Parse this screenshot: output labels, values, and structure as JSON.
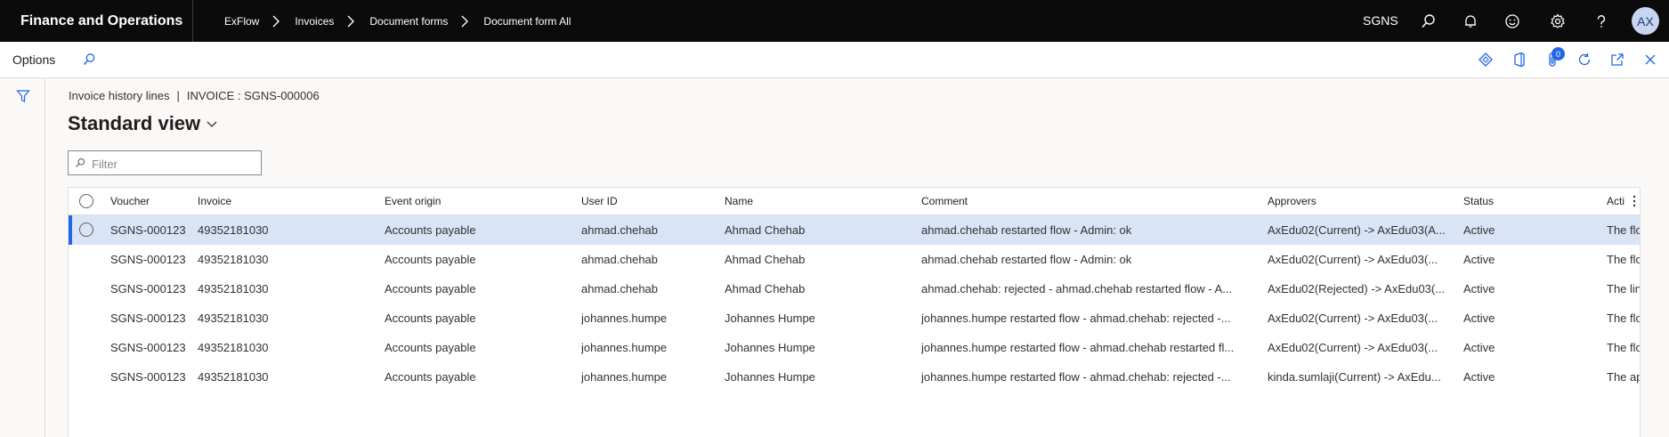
{
  "header": {
    "app_title": "Finance and Operations",
    "breadcrumbs": [
      "ExFlow",
      "Invoices",
      "Document forms",
      "Document form All"
    ],
    "company": "SGNS",
    "avatar_initials": "AX",
    "icons": [
      "search-icon",
      "bell-icon",
      "smiley-icon",
      "gear-icon",
      "help-icon"
    ]
  },
  "actionbar": {
    "options_label": "Options",
    "attachments_count": "0",
    "icons": [
      "search-icon",
      "diamond-icon",
      "office-icon",
      "attachment-icon",
      "refresh-icon",
      "open-new-window-icon",
      "close-icon"
    ]
  },
  "page": {
    "caption_left": "Invoice history lines",
    "caption_sep": "|",
    "caption_right": "INVOICE : SGNS-000006",
    "view_title": "Standard view",
    "filter_placeholder": "Filter"
  },
  "grid": {
    "columns": [
      "Voucher",
      "Invoice",
      "Event origin",
      "User ID",
      "Name",
      "Comment",
      "Approvers",
      "Status",
      "Acti"
    ],
    "rows": [
      {
        "voucher": "SGNS-000123",
        "invoice": "49352181030",
        "event_origin": "Accounts payable",
        "user_id": "ahmad.chehab",
        "name": "Ahmad Chehab",
        "comment": "ahmad.chehab restarted flow - Admin: ok",
        "approvers": "AxEdu02(Current) -> AxEdu03(A...",
        "status": "Active",
        "action": "The flo"
      },
      {
        "voucher": "SGNS-000123",
        "invoice": "49352181030",
        "event_origin": "Accounts payable",
        "user_id": "ahmad.chehab",
        "name": "Ahmad Chehab",
        "comment": "ahmad.chehab restarted flow - Admin: ok",
        "approvers": "AxEdu02(Current) -> AxEdu03(...",
        "status": "Active",
        "action": "The flo"
      },
      {
        "voucher": "SGNS-000123",
        "invoice": "49352181030",
        "event_origin": "Accounts payable",
        "user_id": "ahmad.chehab",
        "name": "Ahmad Chehab",
        "comment": " ahmad.chehab: rejected - ahmad.chehab restarted flow - A...",
        "approvers": "AxEdu02(Rejected) -> AxEdu03(...",
        "status": "Active",
        "action": "The lin"
      },
      {
        "voucher": "SGNS-000123",
        "invoice": "49352181030",
        "event_origin": "Accounts payable",
        "user_id": "johannes.humpe",
        "name": "Johannes Humpe",
        "comment": "johannes.humpe restarted flow -  ahmad.chehab: rejected -...",
        "approvers": "AxEdu02(Current) -> AxEdu03(...",
        "status": "Active",
        "action": "The flo"
      },
      {
        "voucher": "SGNS-000123",
        "invoice": "49352181030",
        "event_origin": "Accounts payable",
        "user_id": "johannes.humpe",
        "name": "Johannes Humpe",
        "comment": "johannes.humpe restarted flow - ahmad.chehab restarted fl...",
        "approvers": "AxEdu02(Current) -> AxEdu03(...",
        "status": "Active",
        "action": "The flo"
      },
      {
        "voucher": "SGNS-000123",
        "invoice": "49352181030",
        "event_origin": "Accounts payable",
        "user_id": "johannes.humpe",
        "name": "Johannes Humpe",
        "comment": "johannes.humpe restarted flow -  ahmad.chehab: rejected -...",
        "approvers": "kinda.sumlaji(Current) -> AxEdu...",
        "status": "Active",
        "action": "The ap"
      }
    ]
  },
  "colors": {
    "topbar": "#0b0b0b",
    "accent": "#2266e3",
    "selected_row": "#d9e4f7"
  }
}
